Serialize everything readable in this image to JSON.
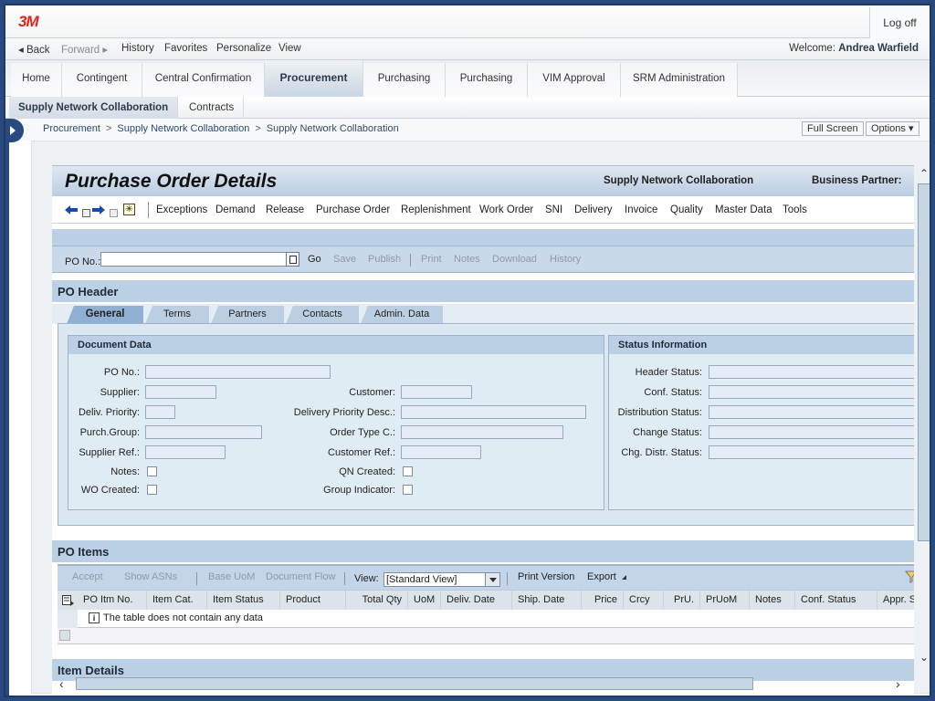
{
  "brand": {
    "logo": "3M",
    "logo_color": "#e2231a",
    "accent": "#2a4a7f"
  },
  "topbar": {
    "logoff_label": "Log off"
  },
  "navbar": {
    "back": "◂ Back",
    "forward": "Forward ▸",
    "history": "History",
    "favorites": "Favorites",
    "personalize": "Personalize",
    "view": "View",
    "welcome_prefix": "Welcome:",
    "user_name": "Andrea Warfield"
  },
  "top_tabs": [
    {
      "label": "Home"
    },
    {
      "label": "Contingent"
    },
    {
      "label": "Central Confirmation"
    },
    {
      "label": "Procurement",
      "active": true
    },
    {
      "label": "Purchasing"
    },
    {
      "label": "Purchasing"
    },
    {
      "label": "VIM Approval"
    },
    {
      "label": "SRM Administration"
    }
  ],
  "second_tabs": [
    {
      "label": "Supply Network Collaboration",
      "active": true
    },
    {
      "label": "Contracts"
    }
  ],
  "breadcrumb": [
    "Procurement",
    "Supply Network Collaboration",
    "Supply Network Collaboration"
  ],
  "breadcrumb_sep": ">",
  "page_actions": {
    "full_screen": "Full Screen",
    "options": "Options ▾"
  },
  "page": {
    "title": "Purchase Order Details",
    "app_name": "Supply Network Collaboration",
    "business_partner_label": "Business Partner:"
  },
  "menu": {
    "icons": [
      "back-arrow-icon",
      "history-back-icon",
      "forward-arrow-icon",
      "history-forward-icon",
      "new-window-icon"
    ],
    "items": [
      "Exceptions",
      "Demand",
      "Release",
      "Purchase Order",
      "Replenishment",
      "Work Order",
      "SNI",
      "Delivery",
      "Invoice",
      "Quality",
      "Master Data",
      "Tools"
    ]
  },
  "po_bar": {
    "label": "PO No.:",
    "value": "",
    "actions": [
      {
        "label": "Go",
        "enabled": true
      },
      {
        "label": "Save",
        "enabled": false
      },
      {
        "label": "Publish",
        "enabled": false
      },
      {
        "label": "Print",
        "enabled": false
      },
      {
        "label": "Notes",
        "enabled": false
      },
      {
        "label": "Download",
        "enabled": false
      },
      {
        "label": "History",
        "enabled": false
      }
    ]
  },
  "po_header": {
    "title": "PO Header",
    "tabs": [
      {
        "label": "General",
        "active": true
      },
      {
        "label": "Terms"
      },
      {
        "label": "Partners"
      },
      {
        "label": "Contacts"
      },
      {
        "label": "Admin. Data"
      }
    ],
    "document_data": {
      "title": "Document Data",
      "left_fields": [
        {
          "label": "PO No.:",
          "value": ""
        },
        {
          "label": "Supplier:",
          "value": ""
        },
        {
          "label": "Deliv. Priority:",
          "value": ""
        },
        {
          "label": "Purch.Group:",
          "value": ""
        },
        {
          "label": "Supplier Ref.:",
          "value": ""
        },
        {
          "label": "Notes:",
          "checked": false
        },
        {
          "label": "WO Created:",
          "checked": false
        }
      ],
      "right_fields": [
        {
          "label": "Customer:",
          "value": ""
        },
        {
          "label": "Delivery Priority Desc.:",
          "value": ""
        },
        {
          "label": "Order Type C.:",
          "value": ""
        },
        {
          "label": "Customer Ref.:",
          "value": ""
        },
        {
          "label": "QN Created:",
          "checked": false
        },
        {
          "label": "Group Indicator:",
          "checked": false
        }
      ]
    },
    "status_info": {
      "title": "Status Information",
      "fields": [
        {
          "label": "Header Status:",
          "value": ""
        },
        {
          "label": "Conf. Status:",
          "value": ""
        },
        {
          "label": "Distribution Status:",
          "value": ""
        },
        {
          "label": "Change Status:",
          "value": ""
        },
        {
          "label": "Chg. Distr. Status:",
          "value": ""
        }
      ]
    }
  },
  "po_items": {
    "title": "PO Items",
    "toolbar": {
      "accept": "Accept",
      "show_asns": "Show ASNs",
      "base_uom": "Base UoM",
      "document_flow": "Document Flow",
      "view_label": "View:",
      "view_selected": "[Standard View]",
      "print_version": "Print Version",
      "export": "Export"
    },
    "columns": [
      "PO Itm No.",
      "Item Cat.",
      "Item Status",
      "Product",
      "Total Qty",
      "UoM",
      "Deliv. Date",
      "Ship. Date",
      "Price",
      "Crcy",
      "PrU.",
      "PrUoM",
      "Notes",
      "Conf. Status",
      "Appr. Sta"
    ],
    "rows": [],
    "empty_message": "The table does not contain any data"
  },
  "item_details": {
    "title": "Item Details"
  }
}
